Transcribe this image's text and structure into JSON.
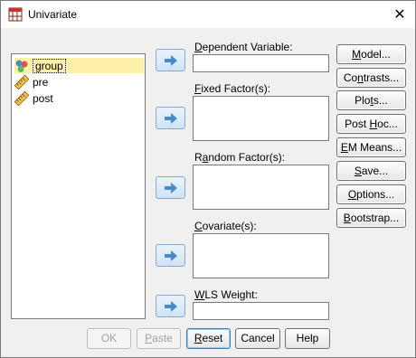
{
  "window": {
    "title": "Univariate",
    "close_symbol": "✕"
  },
  "variables": [
    {
      "label": "group",
      "type": "nominal",
      "selected": true
    },
    {
      "label": "pre",
      "type": "scale",
      "selected": false
    },
    {
      "label": "post",
      "type": "scale",
      "selected": false
    }
  ],
  "fields": {
    "dependent": {
      "label": "Dependent Variable:",
      "ul": "D",
      "rest": "ependent Variable:"
    },
    "fixed": {
      "label": "Fixed Factor(s):",
      "ul": "F",
      "rest": "ixed Factor(s):"
    },
    "random": {
      "pre": "R",
      "ul": "a",
      "rest": "ndom Factor(s):"
    },
    "covariate": {
      "ul": "C",
      "rest": "ovariate(s):"
    },
    "wls": {
      "ul": "W",
      "rest": "LS Weight:"
    }
  },
  "side_buttons": {
    "model": {
      "ul": "M",
      "rest": "odel..."
    },
    "contrasts": {
      "pre": "Co",
      "ul": "n",
      "rest": "trasts..."
    },
    "plots": {
      "pre": "Plo",
      "ul": "t",
      "rest": "s..."
    },
    "posthoc": {
      "pre": "Post ",
      "ul": "H",
      "rest": "oc..."
    },
    "emmeans": {
      "ul": "E",
      "rest": "M Means..."
    },
    "save": {
      "ul": "S",
      "rest": "ave..."
    },
    "options": {
      "ul": "O",
      "rest": "ptions..."
    },
    "bootstrap": {
      "ul": "B",
      "rest": "ootstrap..."
    }
  },
  "bottom_buttons": {
    "ok": "OK",
    "paste": {
      "ul": "P",
      "rest": "aste"
    },
    "reset": {
      "ul": "R",
      "rest": "eset"
    },
    "cancel": "Cancel",
    "help": "Help"
  },
  "colors": {
    "arrow_blue": "#4a8ad0",
    "selected_highlight": "#fff2a8",
    "nominal_red": "#d9534f",
    "nominal_blue": "#4a8ad0",
    "nominal_green": "#5cb85c",
    "scale_ruler": "#e6a23c"
  }
}
